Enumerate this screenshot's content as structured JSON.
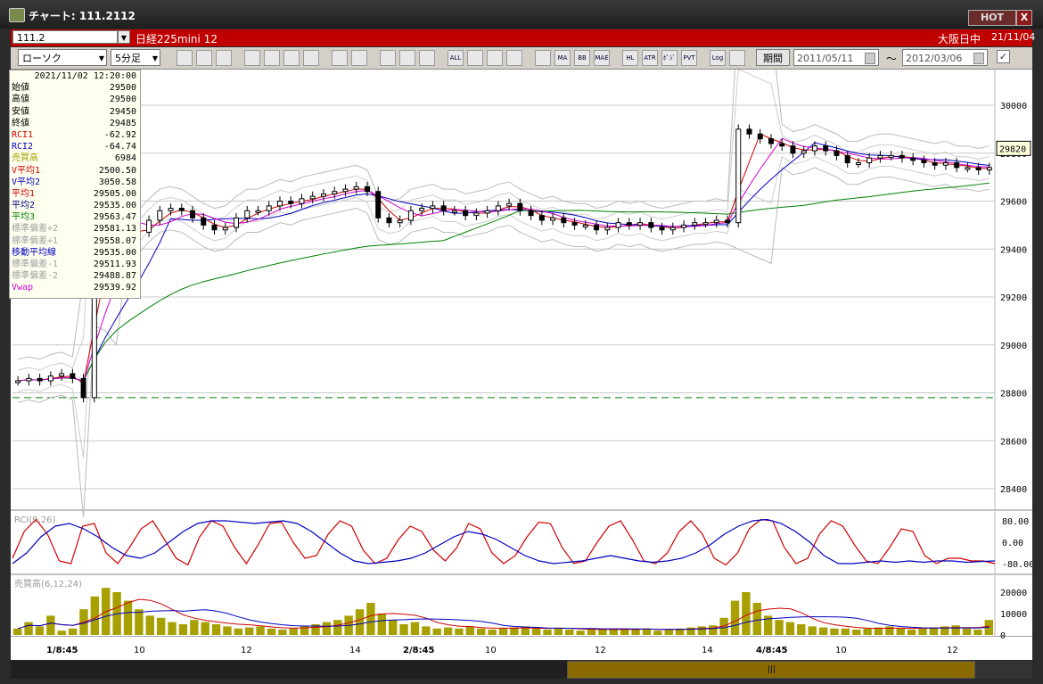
{
  "window": {
    "title": "チャート: 111.2112",
    "hot_label": "HOT",
    "close_label": "X"
  },
  "symbar": {
    "code": "111.2",
    "name": "日経225mini 12",
    "market": "大阪日中",
    "date": "21/11/04"
  },
  "toolbar": {
    "chart_type": "ローソク",
    "interval": "5分足",
    "buttons": [
      "zoom",
      "cross",
      "arrow-down",
      "search",
      "split",
      "scale",
      "help",
      "draw",
      "select",
      "redo",
      "candle",
      "candle2",
      "all",
      "settings",
      "tool",
      "color",
      "marker",
      "ma",
      "bb",
      "mae",
      "hl",
      "atr",
      "psy",
      "pvt",
      "log",
      "export"
    ],
    "button_labels": {
      "all": "ALL",
      "ma": "MA",
      "bb": "BB",
      "mae": "MAE",
      "hl": "HL",
      "atr": "ATR",
      "psy": "ﾎﾟｼﾞ",
      "pvt": "PVT",
      "log": "Log"
    },
    "period_label": "期間",
    "date_from": "2011/05/11",
    "date_to": "2012/03/06",
    "tilde": "～",
    "check": "✓"
  },
  "info": {
    "timestamp": "2021/11/02  12:20:00",
    "rows": [
      {
        "label": "始値",
        "value": "29500",
        "color": "#000000"
      },
      {
        "label": "高値",
        "value": "29500",
        "color": "#000000"
      },
      {
        "label": "安値",
        "value": "29450",
        "color": "#000000"
      },
      {
        "label": "終値",
        "value": "29485",
        "color": "#000000"
      },
      {
        "label": "RCI1",
        "value": "-62.92",
        "color": "#d00000"
      },
      {
        "label": "RCI2",
        "value": "-64.74",
        "color": "#0000c0"
      },
      {
        "label": "売買高",
        "value": "6984",
        "color": "#a0a000"
      },
      {
        "label": "V平均1",
        "value": "2500.50",
        "color": "#d00000"
      },
      {
        "label": "V平均2",
        "value": "3050.58",
        "color": "#0000c0"
      },
      {
        "label": "平均1",
        "value": "29505.00",
        "color": "#d00000"
      },
      {
        "label": "平均2",
        "value": "29535.00",
        "color": "#000080"
      },
      {
        "label": "平均3",
        "value": "29563.47",
        "color": "#008000"
      },
      {
        "label": "標準偏差+2",
        "value": "29581.13",
        "color": "#a0a0a0"
      },
      {
        "label": "標準偏差+1",
        "value": "29558.07",
        "color": "#a0a0a0"
      },
      {
        "label": "移動平均線",
        "value": "29535.00",
        "color": "#0000c0"
      },
      {
        "label": "標準偏差-1",
        "value": "29511.93",
        "color": "#a0a0a0"
      },
      {
        "label": "標準偏差-2",
        "value": "29488.87",
        "color": "#a0a0a0"
      },
      {
        "label": "Vwap",
        "value": "29539.92",
        "color": "#d000d0"
      }
    ]
  },
  "chart_data": {
    "type": "candlestick",
    "y_ticks": [
      "30000",
      "29800",
      "29600",
      "29400",
      "29200",
      "29000",
      "28800",
      "28600",
      "28400"
    ],
    "y_range": [
      28400,
      30000
    ],
    "current_price": "29820",
    "dashed_level": 28780,
    "x_labels": [
      "1/8:45",
      "10",
      "12",
      "14",
      "2/8:45",
      "10",
      "12",
      "14",
      "4/8:45",
      "10",
      "12"
    ],
    "closes": [
      28850,
      28860,
      28850,
      28870,
      28880,
      28860,
      28780,
      29580,
      29560,
      29500,
      29450,
      29470,
      29520,
      29560,
      29570,
      29560,
      29530,
      29500,
      29480,
      29490,
      29530,
      29560,
      29560,
      29580,
      29600,
      29590,
      29610,
      29620,
      29630,
      29640,
      29650,
      29660,
      29640,
      29530,
      29510,
      29520,
      29560,
      29570,
      29580,
      29560,
      29560,
      29540,
      29550,
      29560,
      29580,
      29590,
      29560,
      29540,
      29520,
      29530,
      29510,
      29500,
      29500,
      29480,
      29490,
      29510,
      29500,
      29510,
      29490,
      29480,
      29490,
      29500,
      29510,
      29510,
      29520,
      29510,
      29900,
      29880,
      29860,
      29840,
      29830,
      29800,
      29810,
      29830,
      29810,
      29790,
      29760,
      29760,
      29780,
      29790,
      29790,
      29780,
      29770,
      29760,
      29750,
      29760,
      29740,
      29740,
      29730,
      29740
    ],
    "rci": {
      "label": "RCI(9,26)",
      "ticks": [
        "80.00",
        "0.00",
        "-80.00"
      ],
      "rci1": [
        -60,
        40,
        85,
        30,
        -70,
        -80,
        60,
        70,
        -40,
        -80,
        -20,
        50,
        80,
        10,
        -60,
        -85,
        20,
        80,
        60,
        -20,
        -80,
        -10,
        70,
        75,
        0,
        -60,
        -50,
        30,
        80,
        60,
        -30,
        -80,
        -60,
        10,
        60,
        40,
        -30,
        -70,
        -20,
        70,
        50,
        -40,
        -80,
        -50,
        20,
        75,
        70,
        -20,
        -80,
        -70,
        0,
        60,
        80,
        10,
        -70,
        -80,
        -40,
        40,
        80,
        30,
        -60,
        -85,
        -40,
        50,
        85,
        80,
        -20,
        -80,
        -60,
        30,
        80,
        60,
        -10,
        -70,
        -80,
        -20,
        50,
        40,
        -50,
        -80,
        -60,
        -60,
        -70,
        -70,
        -80
      ],
      "rci2": [
        -80,
        -40,
        20,
        60,
        70,
        50,
        20,
        -20,
        -50,
        -60,
        -40,
        0,
        40,
        70,
        80,
        80,
        75,
        70,
        75,
        80,
        70,
        40,
        0,
        -40,
        -70,
        -80,
        -75,
        -70,
        -60,
        -40,
        -10,
        20,
        40,
        30,
        10,
        -20,
        -50,
        -70,
        -80,
        -75,
        -70,
        -60,
        -50,
        -60,
        -70,
        -75,
        -70,
        -60,
        -40,
        -10,
        30,
        60,
        80,
        85,
        70,
        40,
        0,
        -50,
        -80,
        -80,
        -75,
        -70,
        -75,
        -70,
        -75,
        -70,
        -70,
        -75,
        -72,
        -70
      ]
    },
    "volume": {
      "label": "売買高(6,12,24)",
      "ticks": [
        "20000",
        "10000",
        "0"
      ],
      "bars": [
        3000,
        6000,
        4000,
        9000,
        2000,
        3000,
        12000,
        18000,
        22000,
        20000,
        16000,
        12000,
        9000,
        8000,
        6000,
        5000,
        7000,
        6000,
        5000,
        4000,
        3000,
        3500,
        4000,
        3000,
        2500,
        3000,
        4000,
        5000,
        6000,
        7000,
        9000,
        12000,
        15000,
        10000,
        7000,
        5000,
        6000,
        4000,
        3000,
        3500,
        3000,
        4000,
        3000,
        2500,
        3000,
        3500,
        4000,
        3000,
        2500,
        3000,
        2500,
        2000,
        3000,
        2500,
        3000,
        2500,
        2500,
        3000,
        2000,
        2500,
        3000,
        3500,
        4000,
        4500,
        8000,
        16000,
        20000,
        15000,
        9000,
        7000,
        6000,
        5000,
        4000,
        3500,
        3000,
        3000,
        2500,
        3000,
        3500,
        4000,
        3000,
        2500,
        3000,
        3500,
        4000,
        4500,
        3000,
        2500,
        7000
      ]
    }
  }
}
